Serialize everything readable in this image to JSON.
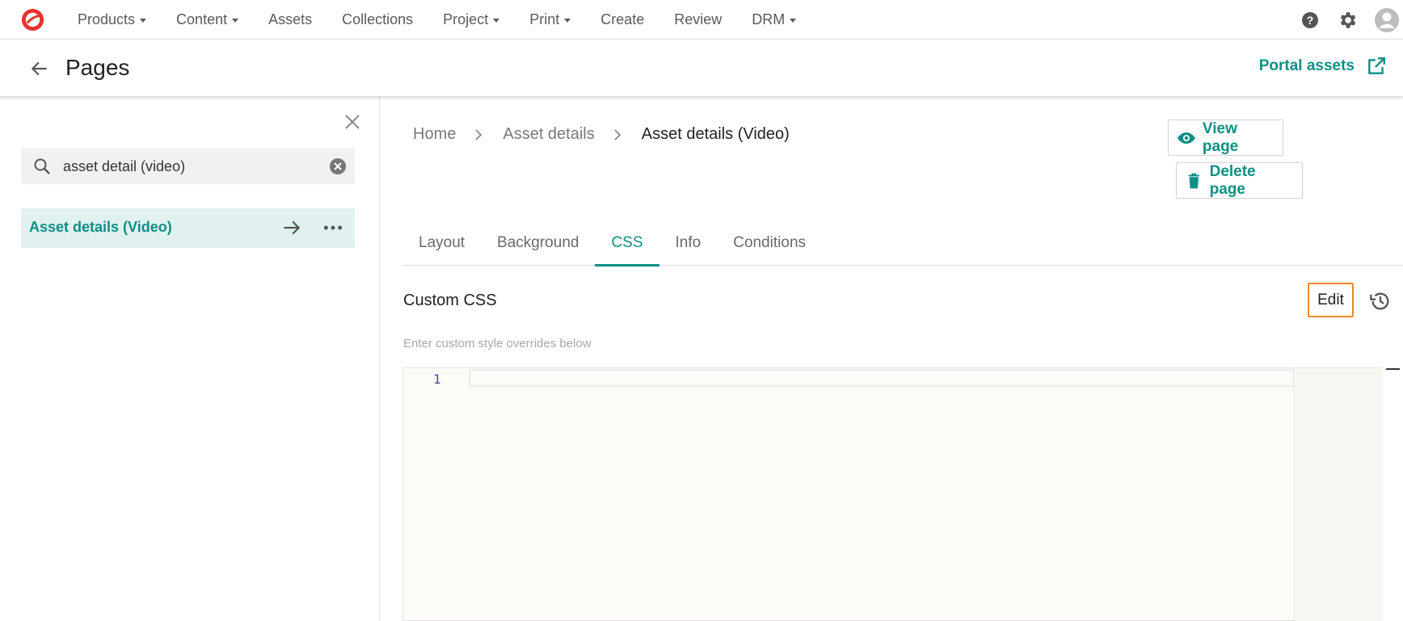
{
  "topnav": {
    "items": [
      {
        "label": "Products",
        "dropdown": true
      },
      {
        "label": "Content",
        "dropdown": true
      },
      {
        "label": "Assets",
        "dropdown": false
      },
      {
        "label": "Collections",
        "dropdown": false
      },
      {
        "label": "Project",
        "dropdown": true
      },
      {
        "label": "Print",
        "dropdown": true
      },
      {
        "label": "Create",
        "dropdown": false
      },
      {
        "label": "Review",
        "dropdown": false
      },
      {
        "label": "DRM",
        "dropdown": true
      }
    ],
    "icons": [
      "help-icon",
      "gear-icon",
      "avatar-icon"
    ]
  },
  "header": {
    "title": "Pages",
    "portal_link": "Portal assets"
  },
  "sidebar": {
    "search": {
      "value": "asset detail (video)",
      "placeholder": ""
    },
    "results": [
      {
        "label": "Asset details (Video)"
      }
    ]
  },
  "main": {
    "breadcrumb": [
      "Home",
      "Asset details",
      "Asset details (Video)"
    ],
    "view_button": "View page",
    "delete_button": "Delete page",
    "tabs": [
      {
        "label": "Layout",
        "active": false
      },
      {
        "label": "Background",
        "active": false
      },
      {
        "label": "CSS",
        "active": true
      },
      {
        "label": "Info",
        "active": false
      },
      {
        "label": "Conditions",
        "active": false
      }
    ],
    "section_title": "Custom CSS",
    "edit_button": "Edit",
    "hint": "Enter custom style overrides below",
    "editor": {
      "line_numbers": [
        "1"
      ]
    }
  },
  "colors": {
    "accent": "#0d8f84",
    "highlight": "#f08a24",
    "selected_bg": "#e1f1f0",
    "logo": "#e8322d"
  }
}
